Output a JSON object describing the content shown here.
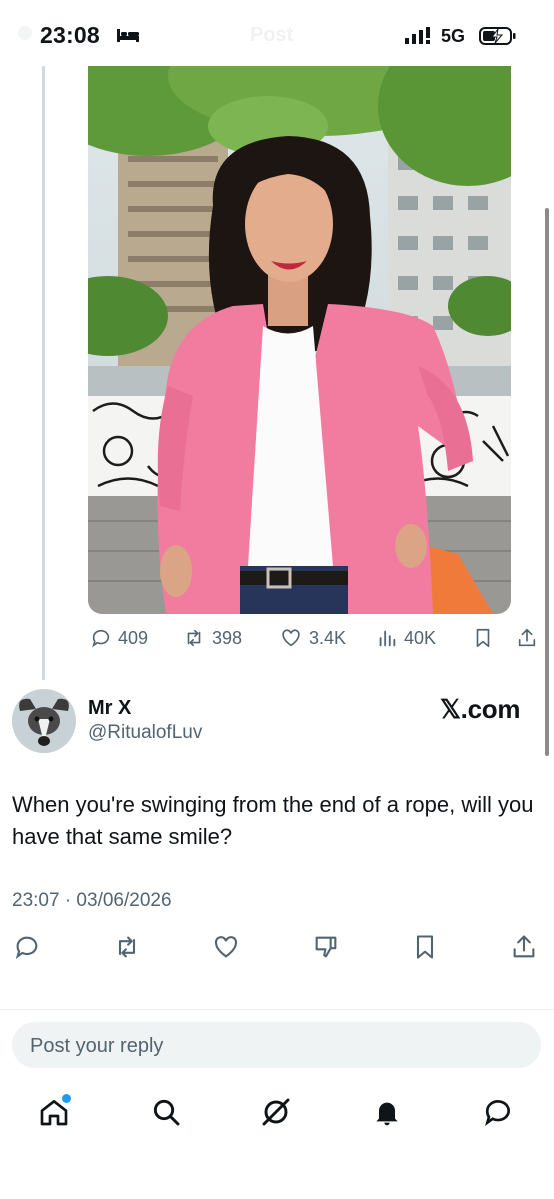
{
  "status_bar": {
    "time": "23:08",
    "network": "5G",
    "icons": [
      "bed-icon",
      "signal-icon",
      "battery-charging-icon"
    ]
  },
  "header": {
    "title": "Post"
  },
  "quoted_post": {
    "image": "photo",
    "stats": {
      "replies": "409",
      "reposts": "398",
      "likes": "3.4K",
      "views": "40K"
    }
  },
  "post": {
    "author_name": "Mr X",
    "author_handle": "@RitualofLuv",
    "source_label": "𝕏.com",
    "text": "When you're swinging from the end of a rope, will you have that same smile?",
    "timestamp": "23:07 · 03/06/2026"
  },
  "reply": {
    "placeholder": "Post your reply"
  },
  "bottom_nav": [
    "home-icon",
    "search-icon",
    "grok-icon",
    "notifications-icon",
    "messages-icon"
  ],
  "colors": {
    "text": "#0f1419",
    "secondary": "#536471",
    "accent": "#1d9bf0",
    "blazer": "#f17ca0",
    "thread": "#cfd9de"
  }
}
